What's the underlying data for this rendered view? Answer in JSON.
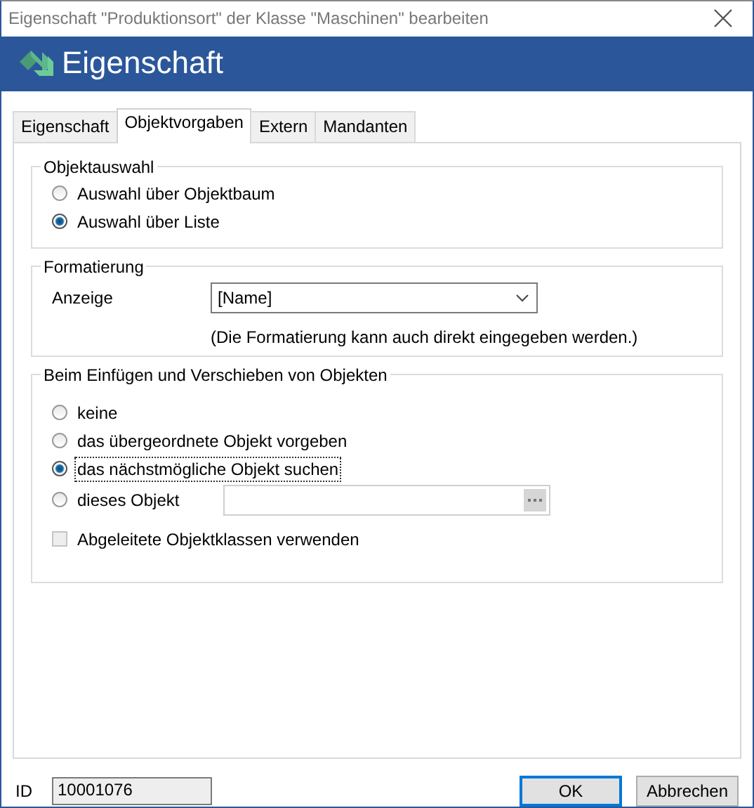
{
  "window": {
    "title": "Eigenschaft \"Produktionsort\" der Klasse \"Maschinen\" bearbeiten"
  },
  "header": {
    "title": "Eigenschaft"
  },
  "tabs": [
    {
      "label": "Eigenschaft",
      "selected": false
    },
    {
      "label": "Objektvorgaben",
      "selected": true
    },
    {
      "label": "Extern",
      "selected": false
    },
    {
      "label": "Mandanten",
      "selected": false
    }
  ],
  "groups": [
    {
      "kind": "radios",
      "legend": "Objektauswahl",
      "options": [
        {
          "kind": "plain",
          "label": "Auswahl über Objektbaum",
          "selected": false,
          "focused": false
        },
        {
          "kind": "plain",
          "label": "Auswahl über Liste",
          "selected": true,
          "focused": false
        }
      ]
    },
    {
      "kind": "format",
      "legend": "Formatierung",
      "label": "Anzeige",
      "value": "[Name]",
      "hint": "(Die Formatierung kann auch direkt eingegeben werden.)"
    },
    {
      "kind": "radios",
      "legend": "Beim Einfügen und Verschieben von Objekten",
      "options": [
        {
          "kind": "plain",
          "label": "keine",
          "selected": false,
          "focused": false
        },
        {
          "kind": "plain",
          "label": "das übergeordnete Objekt vorgeben",
          "selected": false,
          "focused": false
        },
        {
          "kind": "plain",
          "label": "das nächstmögliche Objekt suchen",
          "selected": true,
          "focused": true
        },
        {
          "kind": "field",
          "label": "dieses Objekt",
          "selected": false,
          "focused": false
        }
      ],
      "checkbox": {
        "label": "Abgeleitete Objektklassen verwenden",
        "checked": false,
        "disabled": true
      }
    }
  ],
  "footer": {
    "id_label": "ID",
    "id_value": "10001076",
    "buttons": [
      {
        "label": "OK",
        "default": true
      },
      {
        "label": "Abbrechen",
        "default": false
      }
    ]
  }
}
